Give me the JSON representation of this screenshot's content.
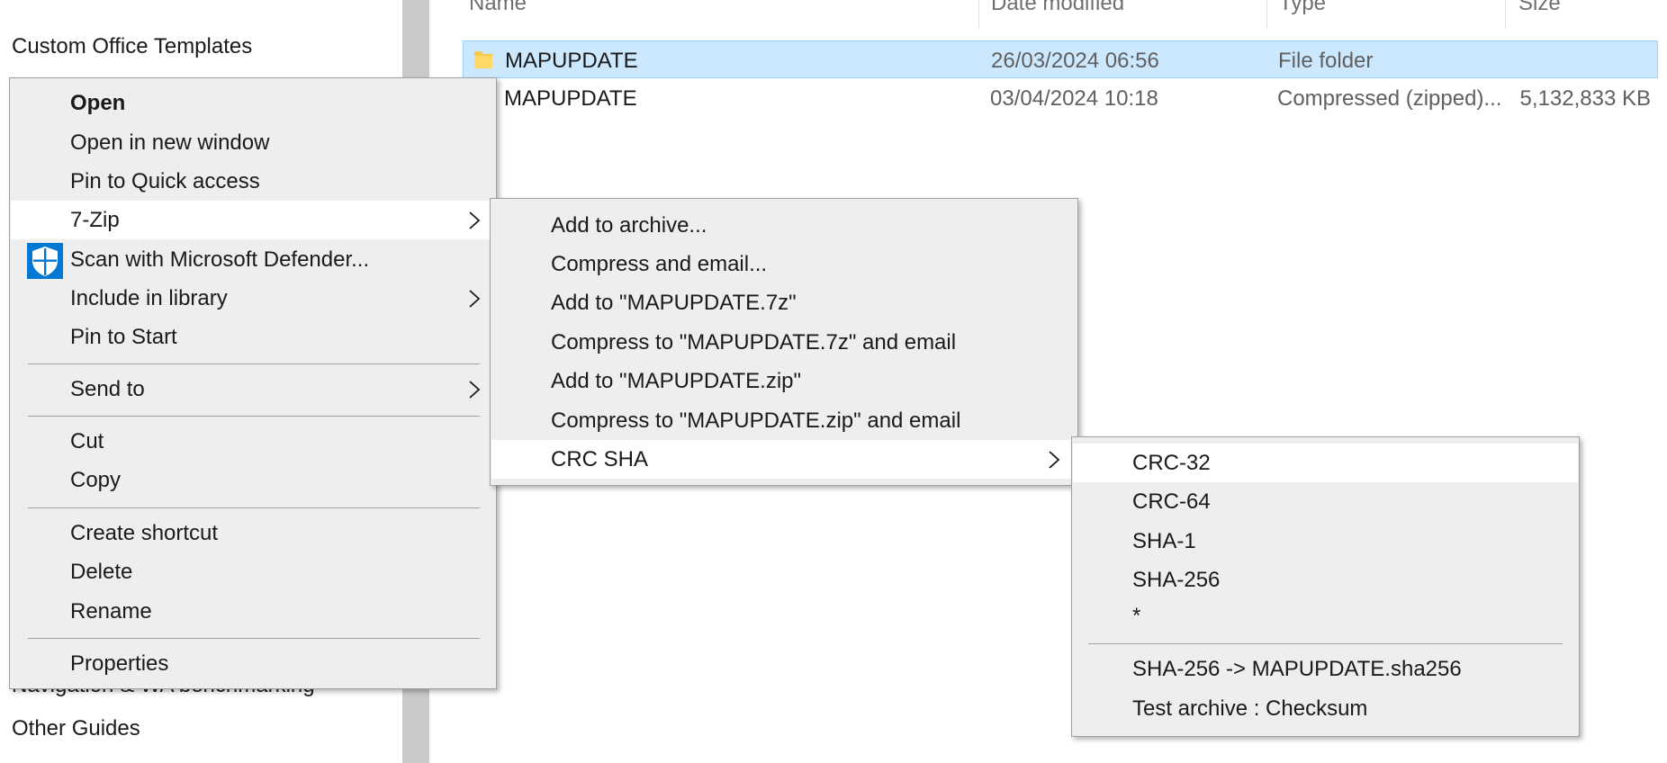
{
  "nav": {
    "items": [
      {
        "label": "Custom Office Templates"
      },
      {
        "label": "Navigation & WA benchmarking"
      },
      {
        "label": "Other Guides"
      }
    ]
  },
  "file_list": {
    "columns": [
      {
        "label": "Name"
      },
      {
        "label": "Date modified"
      },
      {
        "label": "Type"
      },
      {
        "label": "Size"
      }
    ],
    "rows": [
      {
        "name": "MAPUPDATE",
        "date": "26/03/2024 06:56",
        "type": "File folder",
        "size": "",
        "icon": "folder-icon",
        "selected": true
      },
      {
        "name": "MAPUPDATE",
        "date": "03/04/2024 10:18",
        "type": "Compressed (zipped)...",
        "size": "5,132,833 KB",
        "icon": "zip-folder-icon",
        "selected": false
      }
    ]
  },
  "context_menu": {
    "items": [
      {
        "label": "Open",
        "bold": true
      },
      {
        "label": "Open in new window"
      },
      {
        "label": "Pin to Quick access"
      },
      {
        "label": "7-Zip",
        "submenu": true,
        "highlighted": true
      },
      {
        "label": "Scan with Microsoft Defender...",
        "icon": "defender-shield-icon"
      },
      {
        "label": "Include in library",
        "submenu": true
      },
      {
        "label": "Pin to Start"
      },
      {
        "label": "Send to",
        "submenu": true
      },
      {
        "label": "Cut"
      },
      {
        "label": "Copy"
      },
      {
        "label": "Create shortcut"
      },
      {
        "label": "Delete"
      },
      {
        "label": "Rename"
      },
      {
        "label": "Properties"
      }
    ]
  },
  "sevenzip_menu": {
    "items": [
      {
        "label": "Add to archive..."
      },
      {
        "label": "Compress and email..."
      },
      {
        "label": "Add to \"MAPUPDATE.7z\""
      },
      {
        "label": "Compress to \"MAPUPDATE.7z\" and email"
      },
      {
        "label": "Add to \"MAPUPDATE.zip\""
      },
      {
        "label": "Compress to \"MAPUPDATE.zip\" and email"
      },
      {
        "label": "CRC SHA",
        "submenu": true,
        "highlighted": true
      }
    ]
  },
  "crc_menu": {
    "items": [
      {
        "label": "CRC-32",
        "highlighted": true
      },
      {
        "label": "CRC-64"
      },
      {
        "label": "SHA-1"
      },
      {
        "label": "SHA-256"
      },
      {
        "label": "*"
      },
      {
        "label": "SHA-256 -> MAPUPDATE.sha256"
      },
      {
        "label": "Test archive : Checksum"
      }
    ]
  },
  "colors": {
    "selection_bg": "#cce8ff",
    "selection_border": "#99d1ff",
    "menu_bg": "#eeeeee",
    "menu_highlight": "#ffffff",
    "defender_blue": "#0078d4",
    "folder_yellow": "#f8c84a"
  }
}
